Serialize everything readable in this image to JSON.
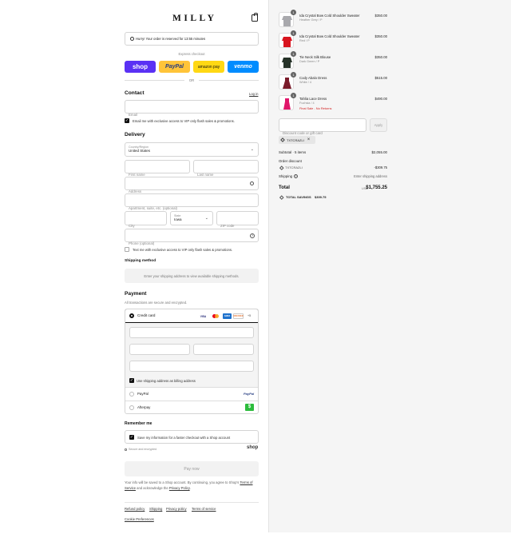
{
  "brand": {
    "logo": "MILLY"
  },
  "notice": {
    "text": "Hurry! Your order is reserved for 13:55 minutes"
  },
  "express": {
    "label": "Express checkout",
    "shop": "shop",
    "paypal": "PayPal",
    "amazon": "amazon pay",
    "venmo": "venmo",
    "or": "OR"
  },
  "contact": {
    "heading": "Contact",
    "login": "Log in",
    "email_placeholder": "Email",
    "offers_label": "Email me with exclusive access to VIP only flash sales & promotions."
  },
  "delivery": {
    "heading": "Delivery",
    "country_label": "Country/Region",
    "country_value": "United States",
    "first_name": "First name",
    "last_name": "Last name",
    "address": "Address",
    "apartment": "Apartment, suite, etc. (optional)",
    "city": "City",
    "state_label": "State",
    "state_value": "Iowa",
    "zip": "ZIP code",
    "phone": "Phone (optional)",
    "text_label": "Text me with exclusive access to VIP only flash sales & promotions."
  },
  "shipping": {
    "heading": "Shipping method",
    "placeholder": "Enter your shipping address to view available shipping methods."
  },
  "payment": {
    "heading": "Payment",
    "subtitle": "All transactions are secure and encrypted.",
    "credit_card": "Credit card",
    "card_visa": "VISA",
    "card_amex": "AMEX",
    "card_discover": "DISCOVER",
    "card_more": "+5",
    "billing_label": "Use shipping address as billing address",
    "paypal": "PayPal",
    "paypal_logo": "PayPal",
    "afterpay": "Afterpay",
    "afterpay_logo": "$"
  },
  "remember": {
    "heading": "Remember me",
    "label": "Save my information for a faster checkout with a Shop account",
    "secure": "Secure and encrypted",
    "shop_logo": "shop"
  },
  "pay_now": "Pay now",
  "legal": {
    "text1": "Your info will be saved to a Shop account. By continuing, you agree to Shop's ",
    "terms": "Terms of Service",
    "text2": " and acknowledge the ",
    "privacy": "Privacy Policy",
    "end": "."
  },
  "footer": {
    "refund": "Refund policy",
    "shipping": "Shipping",
    "privacy": "Privacy policy",
    "terms": "Terms of service",
    "cookie": "Cookie Preferences"
  },
  "cart": {
    "items": [
      {
        "name": "Ida Crystal Bow Cold Shoulder Sweater",
        "variant": "Heather Grey / P",
        "price": "$350.00",
        "qty": "1",
        "color": "#a9a9ad"
      },
      {
        "name": "Ida Crystal Bow Cold Shoulder Sweater",
        "variant": "Red / P",
        "price": "$350.00",
        "qty": "1",
        "color": "#d8141e"
      },
      {
        "name": "Tie Neck Silk Blouse",
        "variant": "Dark Green / P",
        "price": "$350.00",
        "qty": "1",
        "color": "#263228"
      },
      {
        "name": "Cody Abalo Dress",
        "variant": "White / 4",
        "price": "$515.00",
        "qty": "1",
        "color": "#7a1b2a"
      },
      {
        "name": "Tahlia Lace Dress",
        "variant": "Fuchsia / 4",
        "price": "$490.00",
        "qty": "1",
        "color": "#e0176a",
        "note": "Final Sale - No Returns"
      }
    ]
  },
  "discount": {
    "placeholder": "Discount code or gift card",
    "apply": "Apply",
    "tag": "TXTCRAZLI"
  },
  "summary": {
    "subtotal_label": "Subtotal · 5 items",
    "subtotal": "$2,055.00",
    "order_discount_label": "Order discount",
    "discount_code": "TXTCRAZLI",
    "discount_amount": "-$309.75",
    "shipping_label": "Shipping",
    "shipping_value": "Enter shipping address",
    "total_label": "Total",
    "currency": "USD",
    "total": "$1,755.25",
    "savings_label": "TOTAL SAVINGS",
    "savings": "$309.75"
  }
}
